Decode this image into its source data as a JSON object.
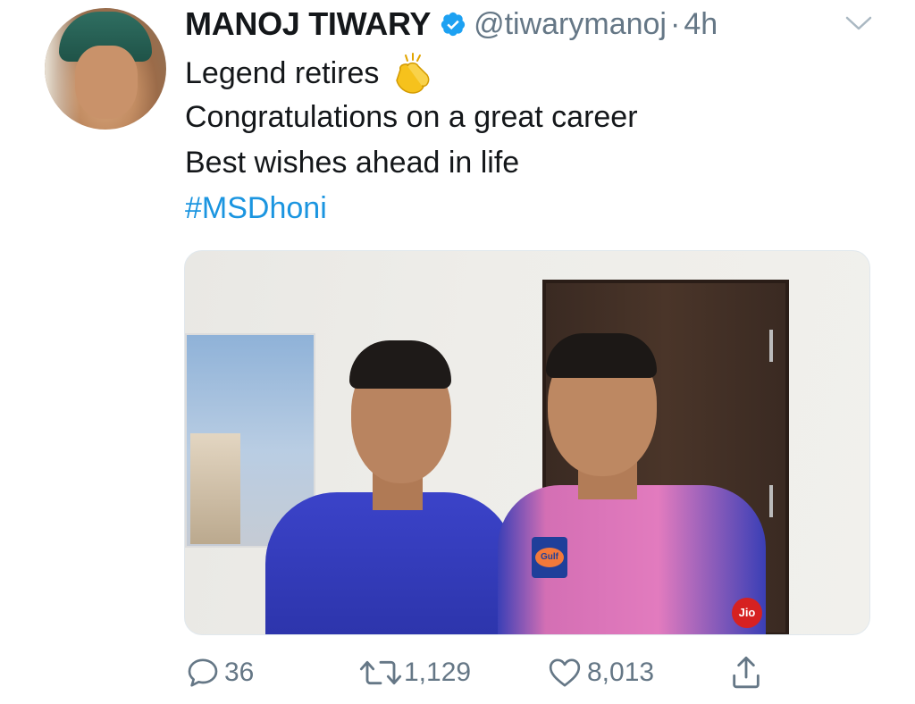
{
  "tweet": {
    "author_name": "MANOJ TIWARY",
    "handle": "@tiwarymanoj",
    "separator": "·",
    "time": "4h",
    "lines": [
      "Legend retires",
      "Congratulations on a great career",
      "Best wishes ahead in life"
    ],
    "hashtag": "#MSDhoni"
  },
  "photo": {
    "jersey_sponsor": "Gulf",
    "jersey_badge": "Jio"
  },
  "actions": {
    "replies": "36",
    "retweets": "1,129",
    "likes": "8,013"
  },
  "colors": {
    "text": "#14171a",
    "secondary": "#657786",
    "link": "#1b95e0",
    "verified": "#1da1f2"
  },
  "icons": [
    "avatar",
    "verified-badge-icon",
    "chevron-down-icon",
    "clapping-hands-emoji",
    "reply-icon",
    "retweet-icon",
    "like-icon",
    "share-icon"
  ]
}
